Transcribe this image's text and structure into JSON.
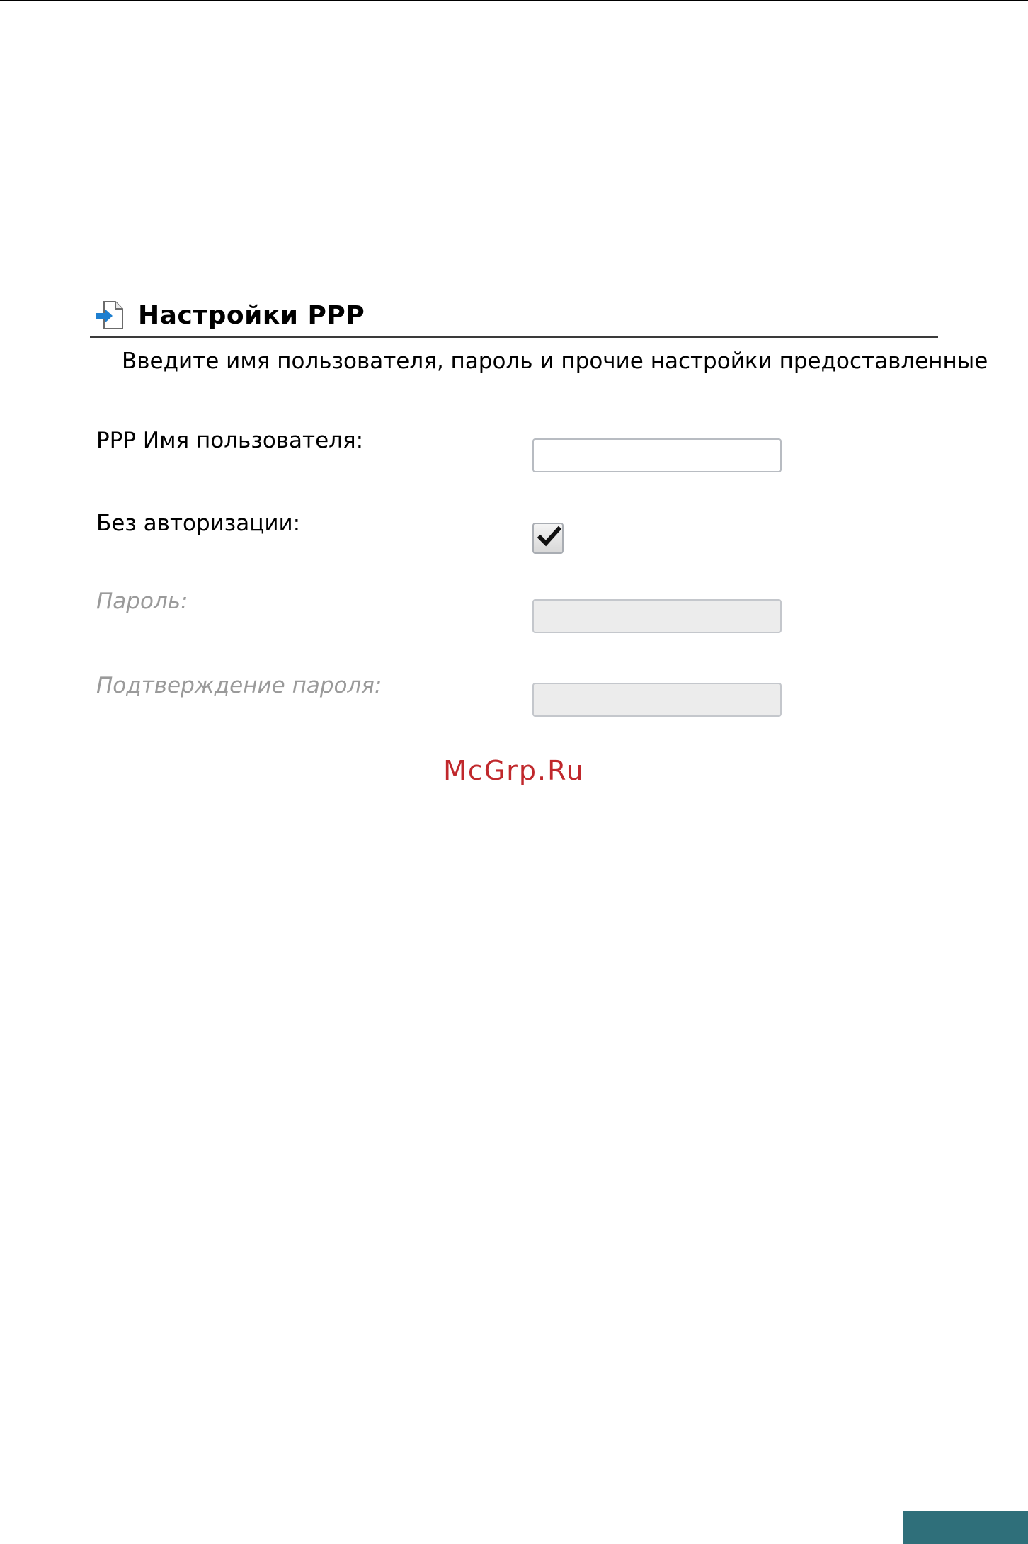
{
  "section": {
    "title": "Настройки PPP",
    "icon": "document-arrow-icon",
    "intro": "Введите имя пользователя, пароль и прочие настройки предоставленные"
  },
  "fields": {
    "username": {
      "label": "PPP Имя пользователя:",
      "value": ""
    },
    "no_auth": {
      "label": "Без авторизации:",
      "checked": true
    },
    "password": {
      "label": "Пароль:",
      "value": "",
      "disabled": true
    },
    "password_confirm": {
      "label": "Подтверждение пароля:",
      "value": "",
      "disabled": true
    }
  },
  "watermark": "McGrp.Ru",
  "colors": {
    "watermark": "#c0282c",
    "icon_arrow": "#1e7fd0",
    "corner_block": "#2f6f7a",
    "disabled_text": "#9a9a9a"
  }
}
